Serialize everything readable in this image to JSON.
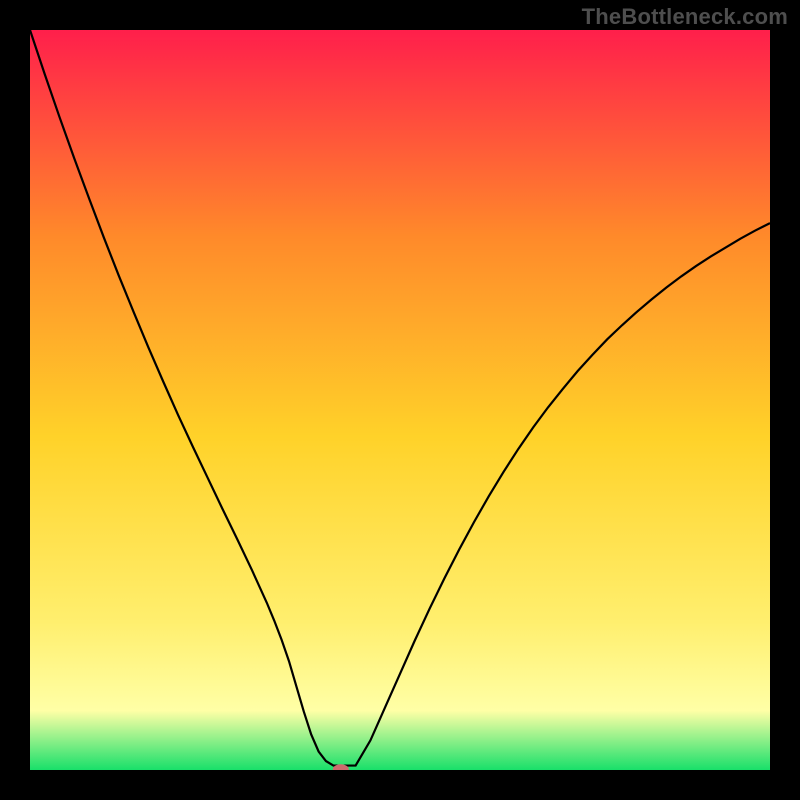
{
  "watermark": "TheBottleneck.com",
  "chart_data": {
    "type": "line",
    "title": "",
    "xlabel": "",
    "ylabel": "",
    "xlim": [
      0,
      100
    ],
    "ylim": [
      0,
      100
    ],
    "background_gradient": {
      "top": "#ff1f4b",
      "upper_mid": "#ff8a2a",
      "mid": "#ffd229",
      "lower_mid": "#ffef6e",
      "band": "#ffffa6",
      "bottom": "#18e06a"
    },
    "axes_visible": false,
    "grid": false,
    "series": [
      {
        "name": "bottleneck-curve",
        "type": "line",
        "x": [
          0,
          2,
          4,
          6,
          8,
          10,
          12,
          14,
          16,
          18,
          20,
          22,
          24,
          26,
          28,
          30,
          32,
          33,
          34,
          35,
          36,
          37,
          38,
          39,
          40,
          41,
          42,
          44,
          46,
          48,
          50,
          52,
          54,
          56,
          58,
          60,
          62,
          64,
          66,
          68,
          70,
          72,
          74,
          76,
          78,
          80,
          82,
          84,
          86,
          88,
          90,
          92,
          94,
          96,
          98,
          100
        ],
        "y": [
          100,
          94,
          88.2,
          82.6,
          77.2,
          71.9,
          66.8,
          61.9,
          57.1,
          52.5,
          48,
          43.7,
          39.5,
          35.3,
          31.2,
          27,
          22.6,
          20.2,
          17.6,
          14.7,
          11.3,
          7.9,
          4.8,
          2.5,
          1.2,
          0.6,
          0.6,
          0.6,
          4.0,
          8.5,
          13.0,
          17.5,
          21.8,
          25.9,
          29.8,
          33.5,
          37.0,
          40.3,
          43.4,
          46.3,
          49.0,
          51.5,
          53.9,
          56.1,
          58.2,
          60.1,
          61.9,
          63.6,
          65.2,
          66.7,
          68.1,
          69.4,
          70.6,
          71.8,
          72.9,
          73.9
        ]
      },
      {
        "name": "marker",
        "type": "scatter",
        "x": [
          42
        ],
        "y": [
          0.1
        ],
        "color": "#cd6a6d"
      }
    ]
  }
}
